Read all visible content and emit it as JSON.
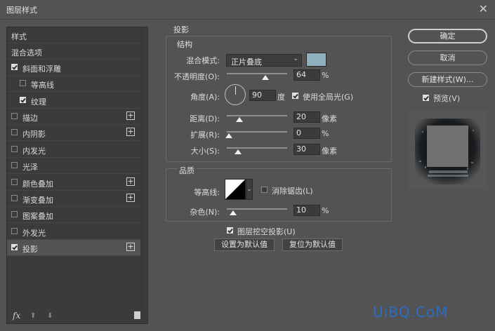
{
  "window": {
    "title": "图层样式",
    "close_glyph": "✕"
  },
  "sidebar": {
    "items": [
      {
        "label": "样式",
        "checkbox": false,
        "checked": false,
        "plus": false,
        "selected": false
      },
      {
        "label": "混合选项",
        "checkbox": false,
        "checked": false,
        "plus": false,
        "selected": false
      },
      {
        "label": "斜面和浮雕",
        "checkbox": true,
        "checked": true,
        "plus": false,
        "selected": false
      },
      {
        "label": "等高线",
        "checkbox": true,
        "checked": false,
        "plus": false,
        "selected": false,
        "indent": true
      },
      {
        "label": "纹理",
        "checkbox": true,
        "checked": true,
        "plus": false,
        "selected": false,
        "indent": true
      },
      {
        "label": "描边",
        "checkbox": true,
        "checked": false,
        "plus": true,
        "selected": false
      },
      {
        "label": "内阴影",
        "checkbox": true,
        "checked": false,
        "plus": true,
        "selected": false
      },
      {
        "label": "内发光",
        "checkbox": true,
        "checked": false,
        "plus": false,
        "selected": false
      },
      {
        "label": "光泽",
        "checkbox": true,
        "checked": false,
        "plus": false,
        "selected": false
      },
      {
        "label": "颜色叠加",
        "checkbox": true,
        "checked": false,
        "plus": true,
        "selected": false
      },
      {
        "label": "渐变叠加",
        "checkbox": true,
        "checked": false,
        "plus": true,
        "selected": false
      },
      {
        "label": "图案叠加",
        "checkbox": true,
        "checked": false,
        "plus": false,
        "selected": false
      },
      {
        "label": "外发光",
        "checkbox": true,
        "checked": false,
        "plus": false,
        "selected": false
      },
      {
        "label": "投影",
        "checkbox": true,
        "checked": true,
        "plus": true,
        "selected": true
      }
    ],
    "footer": {
      "fx": "fx",
      "up": "⬆",
      "down": "⬇"
    }
  },
  "drop_shadow": {
    "section_title": "投影",
    "structure_title": "结构",
    "blend_mode_label": "混合模式:",
    "blend_mode_value": "正片叠底",
    "shadow_color": "#8fb0be",
    "opacity_label": "不透明度(O):",
    "opacity_value": "64",
    "opacity_fraction": 0.64,
    "opacity_unit": "%",
    "angle_label": "角度(A):",
    "angle_value": "90",
    "angle_unit": "度",
    "global_light_label": "使用全局光(G)",
    "global_light_checked": true,
    "distance_label": "距离(D):",
    "distance_value": "20",
    "distance_unit": "像素",
    "spread_label": "扩展(R):",
    "spread_value": "0",
    "spread_unit": "%",
    "size_label": "大小(S):",
    "size_value": "30",
    "size_unit": "像素",
    "quality_title": "品质",
    "contour_label": "等高线:",
    "anti_alias_label": "消除锯齿(L)",
    "anti_alias_checked": false,
    "noise_label": "杂色(N):",
    "noise_value": "10",
    "noise_unit": "%",
    "knockout_label": "图层挖空投影(U)",
    "knockout_checked": true,
    "make_default": "设置为默认值",
    "reset_default": "复位为默认值"
  },
  "right": {
    "ok": "确定",
    "cancel": "取消",
    "new_style": "新建样式(W)...",
    "preview_label": "预览(V)",
    "preview_checked": true
  },
  "watermark": "UiBQ.CoM"
}
